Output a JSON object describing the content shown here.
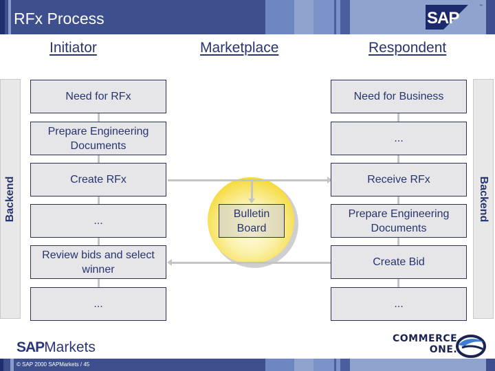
{
  "header": {
    "title": "RFx Process",
    "logo": "SAP",
    "trademark": "™"
  },
  "columns": {
    "initiator": "Initiator",
    "marketplace": "Marketplace",
    "respondent": "Respondent"
  },
  "backend": {
    "left_label": "Backend",
    "right_label": "Backend"
  },
  "initiator_steps": [
    "Need for RFx",
    "Prepare Engineering Documents",
    "Create RFx",
    "...",
    "Review bids and select winner",
    "..."
  ],
  "respondent_steps": [
    "Need for Business",
    "...",
    "Receive RFx",
    "Prepare Engineering Documents",
    "Create Bid",
    "..."
  ],
  "marketplace": {
    "hub_label": "Bulletin Board"
  },
  "footer": {
    "brand_bold": "SAP",
    "brand_rest": "Markets",
    "copyright": "© SAP 2000 SAPMarkets  / 45",
    "partner_line1": "COMMERCE",
    "partner_line2": "ONE."
  },
  "colors": {
    "header_bg": "#3d4f8d",
    "text_navy": "#283470",
    "box_fill": "#e6e6e8",
    "connector": "#c4c4c4",
    "bulletin_yellow": "#f4d832"
  }
}
